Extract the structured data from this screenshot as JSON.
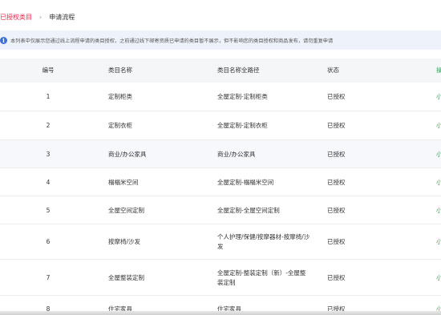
{
  "breadcrumb": {
    "link": "已授权类目",
    "separator": "›",
    "current": "申请流程"
  },
  "notice": {
    "icon": "info-icon",
    "text": "本列表中仅展示您通过线上流程申请的类目授权，之前通过线下邮寄资质已申请的类目暂不展示，但不影响您的类目授权和商品发布，请勿重复申请"
  },
  "table": {
    "headers": {
      "no": "编号",
      "name": "类目名称",
      "path": "类目名称全路径",
      "status": "状态",
      "op": "操"
    },
    "rows": [
      {
        "no": "1",
        "name": "定制柜类",
        "path": "全屋定制-定制柜类",
        "status": "已授权",
        "op": "小"
      },
      {
        "no": "2",
        "name": "定制衣柜",
        "path": "全屋定制-定制衣柜",
        "status": "已授权",
        "op": "小"
      },
      {
        "no": "3",
        "name": "商业/办公家具",
        "path": "商业/办公家具",
        "status": "已授权",
        "op": "小"
      },
      {
        "no": "4",
        "name": "榻榻米空间",
        "path": "全屋定制-榻榻米空间",
        "status": "已授权",
        "op": "小"
      },
      {
        "no": "5",
        "name": "全屋空间定制",
        "path": "全屋定制-全屋空间定制",
        "status": "已授权",
        "op": "小"
      },
      {
        "no": "6",
        "name": "按摩椅/沙发",
        "path": "个人护理/保健/按摩器材-按摩椅/沙发",
        "status": "已授权",
        "op": "小"
      },
      {
        "no": "7",
        "name": "全屋整装定制",
        "path": "全屋定制-整装定制（新）-全屋整装定制",
        "status": "已授权",
        "op": "小"
      },
      {
        "no": "8",
        "name": "住宅家具",
        "path": "住宅家具",
        "status": "已授权",
        "op": "小"
      }
    ]
  }
}
